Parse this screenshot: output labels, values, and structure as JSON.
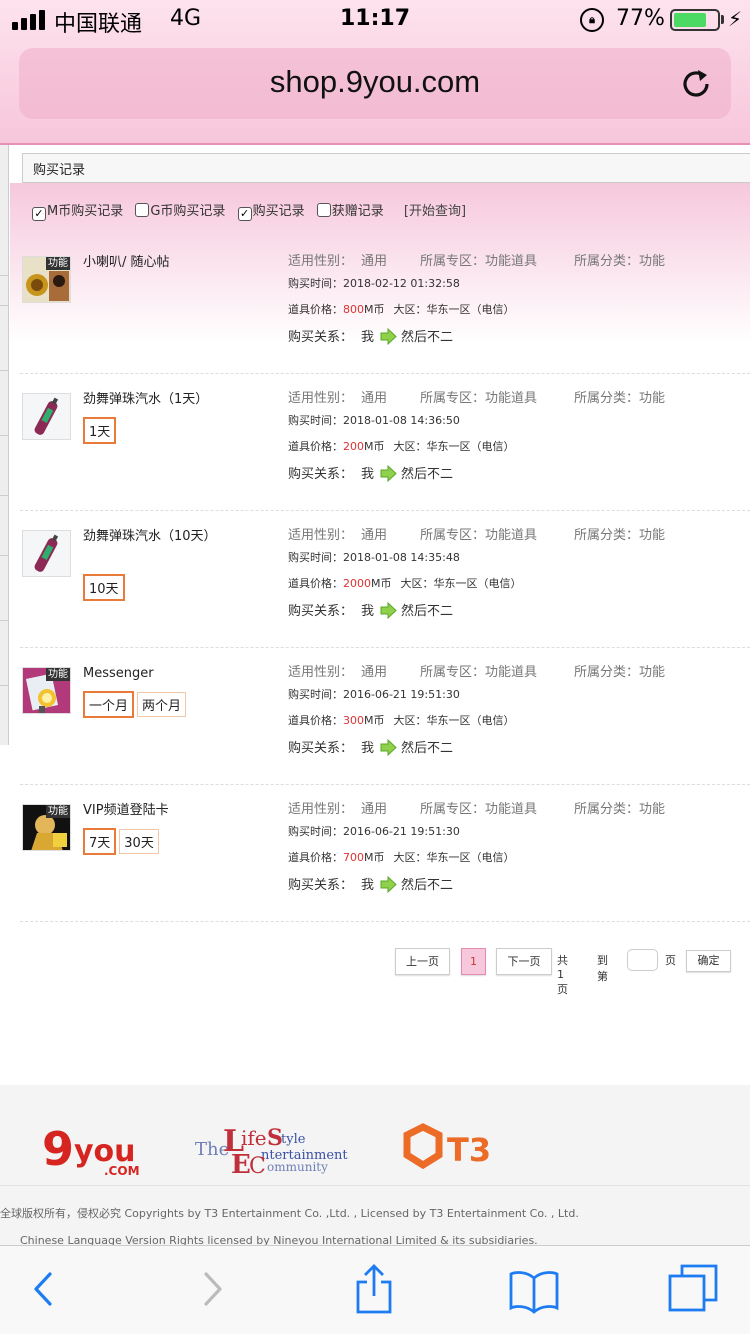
{
  "status_bar": {
    "carrier": "中国联通",
    "network": "4G",
    "time": "11:17",
    "battery_pct": "77%",
    "battery_level": 0.77
  },
  "browser": {
    "url": "shop.9you.com"
  },
  "page": {
    "tab_title": "购买记录",
    "filters": [
      {
        "label": "M币购买记录",
        "checked": true
      },
      {
        "label": "G币购买记录",
        "checked": false
      },
      {
        "label": "购买记录",
        "checked": true
      },
      {
        "label": "获赠记录",
        "checked": false
      }
    ],
    "query_button": "[开始查询]",
    "labels": {
      "gender": "适用性别：",
      "zone": "所属专区：",
      "category": "所属分类：",
      "buy_time": "购买时间：",
      "price": "道具价格：",
      "region": "大区：",
      "relation": "购买关系："
    },
    "records": [
      {
        "name": "小喇叭/ 随心帖",
        "tag": "功能",
        "options": [],
        "gender": "通用",
        "zone": "功能道具",
        "category": "功能",
        "time": "2018-02-12 01:32:58",
        "price": "800",
        "currency": "M币",
        "region": "华东一区（电信）",
        "from": "我",
        "to": "然后不二"
      },
      {
        "name": "劲舞弹珠汽水（1天）",
        "tag": "",
        "options": [
          "1天"
        ],
        "gender": "通用",
        "zone": "功能道具",
        "category": "功能",
        "time": "2018-01-08 14:36:50",
        "price": "200",
        "currency": "M币",
        "region": "华东一区（电信）",
        "from": "我",
        "to": "然后不二"
      },
      {
        "name": "劲舞弹珠汽水（10天）",
        "tag": "",
        "options": [
          "10天"
        ],
        "gender": "通用",
        "zone": "功能道具",
        "category": "功能",
        "time": "2018-01-08 14:35:48",
        "price": "2000",
        "currency": "M币",
        "region": "华东一区（电信）",
        "from": "我",
        "to": "然后不二"
      },
      {
        "name": "Messenger",
        "tag": "功能",
        "options": [
          "一个月",
          "两个月"
        ],
        "gender": "通用",
        "zone": "功能道具",
        "category": "功能",
        "time": "2016-06-21 19:51:30",
        "price": "300",
        "currency": "M币",
        "region": "华东一区（电信）",
        "from": "我",
        "to": "然后不二"
      },
      {
        "name": "VIP频道登陆卡",
        "tag": "功能",
        "options": [
          "7天",
          "30天"
        ],
        "gender": "通用",
        "zone": "功能道具",
        "category": "功能",
        "time": "2016-06-21 19:51:30",
        "price": "700",
        "currency": "M币",
        "region": "华东一区（电信）",
        "from": "我",
        "to": "然后不二"
      }
    ],
    "pagination": {
      "prev": "上一页",
      "current": "1",
      "next": "下一页",
      "total": "共1页",
      "goto": "到第",
      "page_unit": "页",
      "confirm": "确定"
    }
  },
  "footer": {
    "logos": [
      "9you.com",
      "The LifeStyle Entertainment Community",
      "T3"
    ],
    "copyright": "全球版权所有，侵权必究 Copyrights by T3 Entertainment Co. ,Ltd. , Licensed by T3 Entertainment Co. , Ltd.",
    "license": "Chinese Language Version Rights licensed by Nineyou International Limited & its subsidiaries."
  },
  "toolbar": {
    "icons": [
      "back-icon",
      "forward-icon",
      "share-icon",
      "bookmarks-icon",
      "tabs-icon"
    ]
  }
}
